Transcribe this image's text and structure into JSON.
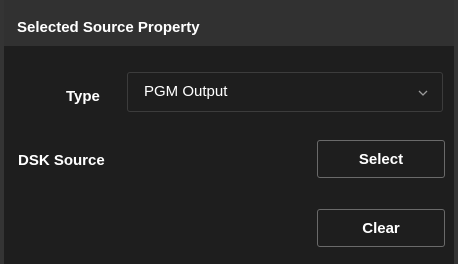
{
  "panel": {
    "title": "Selected Source Property"
  },
  "type_field": {
    "label": "Type",
    "value": "PGM Output",
    "icon": "chevron-down-icon"
  },
  "dsk_source": {
    "label": "DSK Source",
    "select_label": "Select",
    "clear_label": "Clear"
  },
  "colors": {
    "panel_bg": "#1e1e1e",
    "header_bg": "#313131",
    "text": "#ffffff",
    "button_border": "#6a6a6a"
  }
}
